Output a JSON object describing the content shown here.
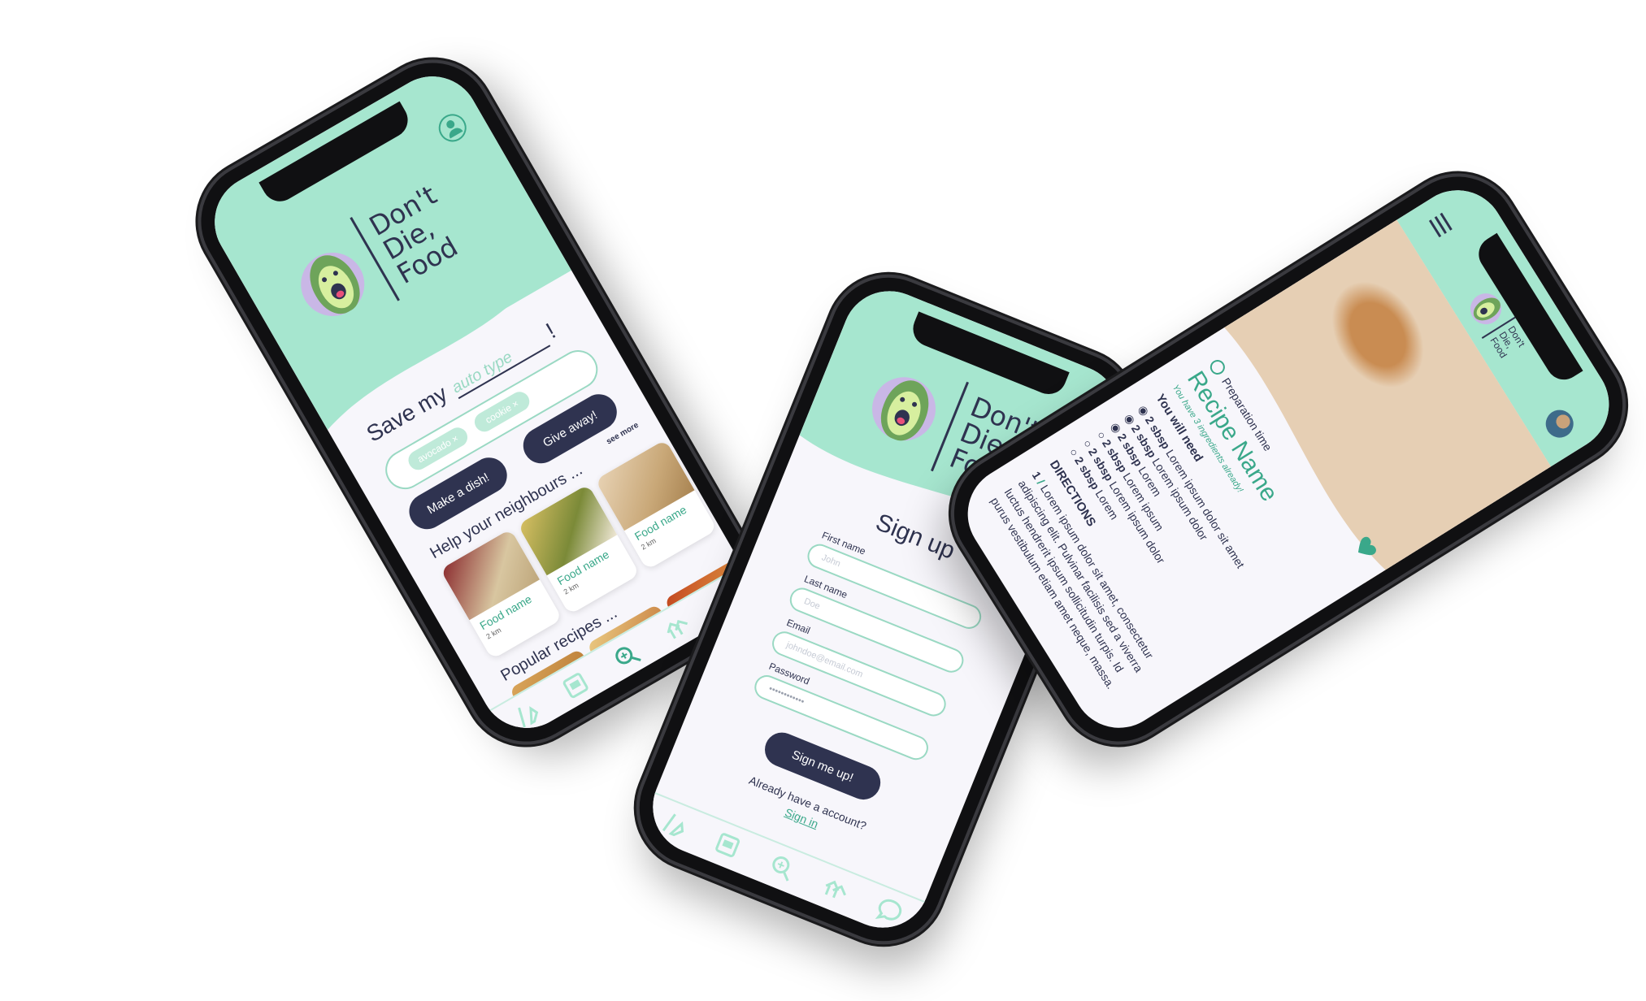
{
  "app": {
    "brand_line1": "Don't",
    "brand_line2": "Die,",
    "brand_line3": "Food"
  },
  "home": {
    "headline_prefix": "Save my",
    "headline_input": "auto type",
    "headline_suffix": "!",
    "chips": [
      "avocado ×",
      "cookie ×"
    ],
    "make_dish_label": "Make a dish!",
    "give_away_label": "Give away!",
    "see_more": "see more",
    "neighbours_title": "Help your neighbours ...",
    "neighbour_items": [
      {
        "name": "Food name",
        "distance": "2 km"
      },
      {
        "name": "Food name",
        "distance": "2 km"
      },
      {
        "name": "Food name",
        "distance": "2 km"
      }
    ],
    "recipes_title": "Popular recipes ..."
  },
  "signup": {
    "title": "Sign up",
    "first_name_label": "First name",
    "first_name_placeholder": "John",
    "last_name_label": "Last name",
    "last_name_placeholder": "Doe",
    "email_label": "Email",
    "email_placeholder": "johndoe@email.com",
    "password_label": "Password",
    "password_placeholder": "••••••••••••",
    "submit_label": "Sign me up!",
    "have_account": "Already have a account?",
    "sign_in_link": "Sign in"
  },
  "recipe": {
    "prep_label": "Preparation time",
    "title": "Recipe Name",
    "subtitle": "You have 3 ingredients already!",
    "need_title": "You will need",
    "ingredients": [
      {
        "qty": "2 sbsp",
        "name": "Lorem ipsum dolor sit amet",
        "have": true
      },
      {
        "qty": "2 sbsp",
        "name": "Lorem ipsum dolor",
        "have": true
      },
      {
        "qty": "2 sbsp",
        "name": "Lorem",
        "have": true
      },
      {
        "qty": "2 sbsp",
        "name": "Lorem ipsum",
        "have": false
      },
      {
        "qty": "2 sbsp",
        "name": "Lorem ipsum dolor",
        "have": false
      },
      {
        "qty": "2 sbsp",
        "name": "Lorem",
        "have": false
      }
    ],
    "directions_title": "DIRECTIONS",
    "step_number": "1",
    "step_text": "Lorem ipsum dolor sit amet, consectetur adipiscing elit. Pulvinar facilisis sed a viverra luctus hendrerit ipsum sollicitudin turpis. Id purus vestibulum etiam amet neque, massa."
  },
  "nav_icons": [
    "fridge-icon",
    "recipe-book-icon",
    "search-icon",
    "neighbours-icon",
    "chat-icon"
  ],
  "colors": {
    "mint": "#a6e6cf",
    "teal": "#3aa88a",
    "navy": "#2f3350",
    "background": "#f7f6fb"
  }
}
